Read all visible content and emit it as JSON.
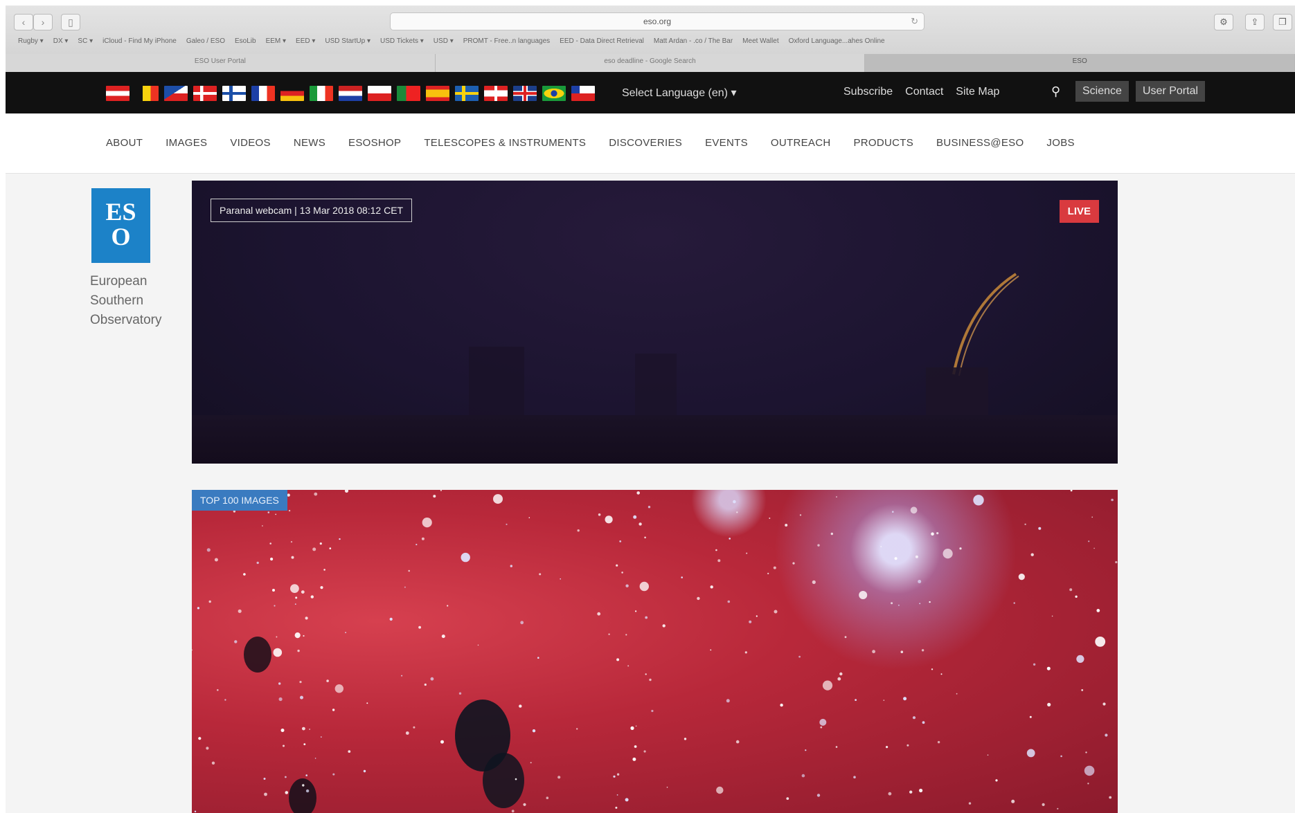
{
  "browser": {
    "url": "eso.org",
    "bookmarks": [
      "Rugby ▾",
      "DX ▾",
      "SC ▾",
      "iCloud - Find My iPhone",
      "Galeo / ESO",
      "EsoLib",
      "EEM ▾",
      "EED ▾",
      "USD StartUp ▾",
      "USD Tickets ▾",
      "USD ▾",
      "PROMT - Free..n languages",
      "EED - Data Direct Retrieval",
      "Matt Ardan - .co / The Bar",
      "Meet Wallet",
      "Oxford Language...ahes Online"
    ],
    "tabs": [
      {
        "label": "ESO User Portal",
        "active": false
      },
      {
        "label": "eso deadline - Google Search",
        "active": false
      },
      {
        "label": "ESO",
        "active": true
      }
    ]
  },
  "topbar": {
    "flags": [
      "austria",
      "belgium",
      "czech",
      "denmark",
      "finland",
      "france",
      "germany",
      "italy",
      "netherlands",
      "poland",
      "portugal",
      "spain",
      "sweden",
      "switzerland",
      "uk",
      "brazil",
      "chile"
    ],
    "language_select": "Select Language (en)",
    "links": [
      "Subscribe",
      "Contact",
      "Site Map"
    ],
    "science_label": "Science",
    "user_portal_label": "User Portal"
  },
  "nav": [
    "ABOUT",
    "IMAGES",
    "VIDEOS",
    "NEWS",
    "ESOSHOP",
    "TELESCOPES & INSTRUMENTS",
    "DISCOVERIES",
    "EVENTS",
    "OUTREACH",
    "PRODUCTS",
    "BUSINESS@ESO",
    "JOBS"
  ],
  "logo": {
    "letters": "ES\nO",
    "name_line1": "European",
    "name_line2": "Southern",
    "name_line3": "Observatory",
    "color": "#1c82c8"
  },
  "webcam": {
    "caption": "Paranal webcam | 13 Mar 2018 08:12 CET",
    "live_label": "LIVE",
    "live_color": "#d93a3f"
  },
  "featured": {
    "label": "TOP 100 IMAGES"
  }
}
